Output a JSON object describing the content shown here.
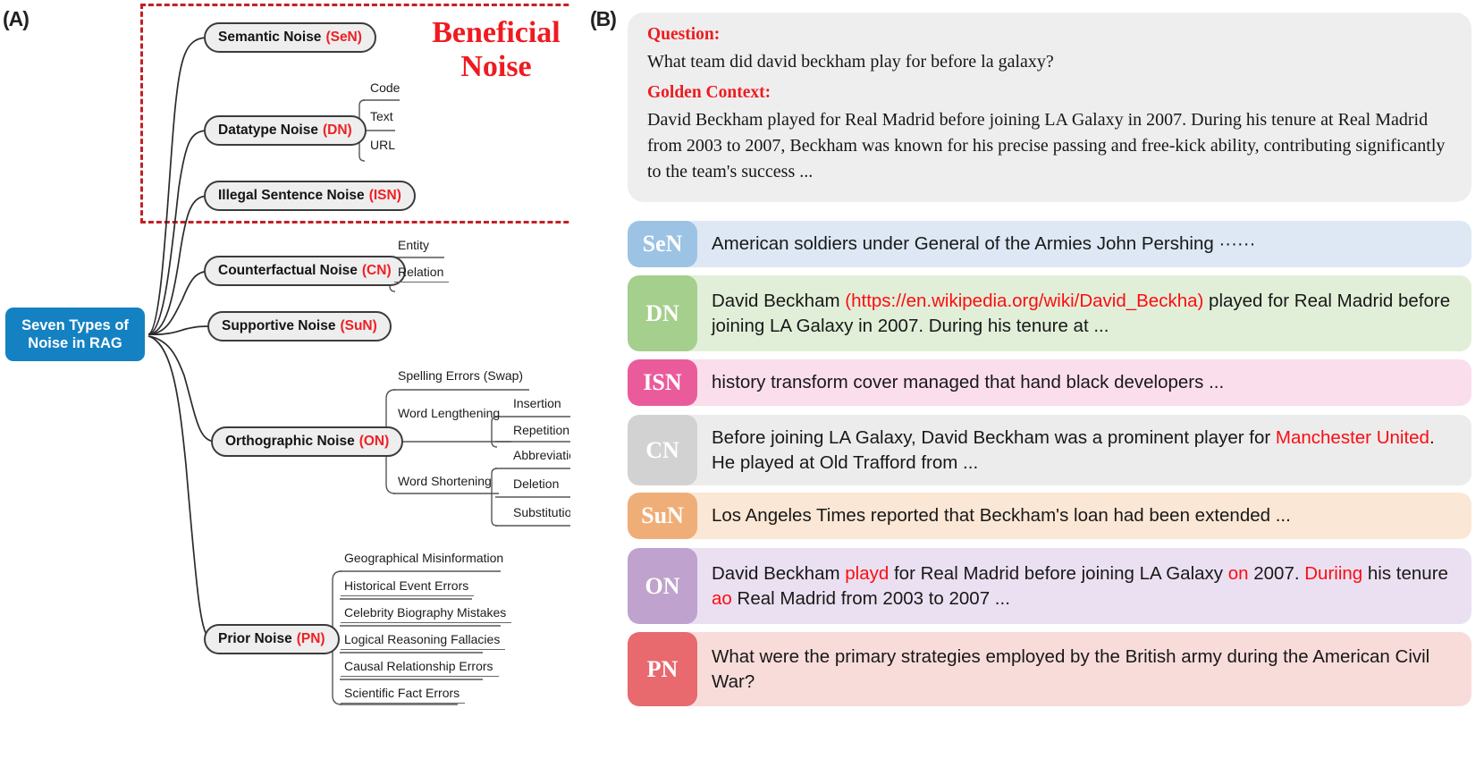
{
  "panels": {
    "a_label": "(A)",
    "b_label": "(B)"
  },
  "diagram": {
    "beneficial_title": "Beneficial Noise",
    "root_node": "Seven Types of Noise in RAG",
    "root_color": "#1481c2",
    "accent_color": "#ef2024",
    "dashed_border_color": "#c32026",
    "branches": [
      {
        "label": "Semantic Noise",
        "abbr": "(SeN)",
        "children": []
      },
      {
        "label": "Datatype Noise",
        "abbr": "(DN)",
        "children": [
          "Code",
          "Text",
          "URL"
        ]
      },
      {
        "label": "Illegal Sentence Noise",
        "abbr": "(ISN)",
        "children": []
      },
      {
        "label": "Counterfactual Noise",
        "abbr": "(CN)",
        "children": [
          "Entity",
          "Relation"
        ]
      },
      {
        "label": "Supportive Noise",
        "abbr": "(SuN)",
        "children": []
      },
      {
        "label": "Orthographic Noise",
        "abbr": "(ON)",
        "children": [
          "Spelling Errors (Swap)",
          "Word Lengthening",
          "Word Shortening"
        ],
        "grandchildren": [
          "Insertion",
          "Repetition",
          "Abbreviation",
          "Deletion",
          "Substitution"
        ]
      },
      {
        "label": "Prior Noise",
        "abbr": "(PN)",
        "children": [
          "Geographical Misinformation",
          "Historical Event Errors",
          "Celebrity Biography Mistakes",
          "Logical Reasoning Fallacies",
          "Causal Relationship Errors",
          "Scientific Fact Errors"
        ]
      }
    ]
  },
  "examples": {
    "question_header": "Question:",
    "question_text": "What team did david beckham play for before la galaxy?",
    "context_header": "Golden Context:",
    "context_text": "David Beckham played for Real Madrid before joining LA Galaxy in 2007. During his tenure at Real Madrid from 2003 to 2007, Beckham was known for his precise passing and free-kick ability, contributing significantly to the team's success ...",
    "rows": [
      {
        "tag": "SeN",
        "tag_color": "#9cc3e3",
        "row_color": "#dde8f4",
        "segments": [
          {
            "t": "American soldiers under General of the Armies John Pershing ······",
            "hl": false
          }
        ]
      },
      {
        "tag": "DN",
        "tag_color": "#a5cf8c",
        "row_color": "#e2efd8",
        "segments": [
          {
            "t": "David Beckham ",
            "hl": false
          },
          {
            "t": "(https://en.wikipedia.org/wiki/David_Beckha)",
            "hl": true
          },
          {
            "t": " played for Real Madrid before joining LA Galaxy in 2007. During his tenure at ...",
            "hl": false
          }
        ]
      },
      {
        "tag": "ISN",
        "tag_color": "#ea5b9c",
        "row_color": "#fbdeeb",
        "segments": [
          {
            "t": "history transform cover managed that hand black developers ...",
            "hl": false
          }
        ]
      },
      {
        "tag": "CN",
        "tag_color": "#d2d2d2",
        "row_color": "#ececec",
        "segments": [
          {
            "t": "Before joining LA Galaxy, David Beckham was a prominent player for ",
            "hl": false
          },
          {
            "t": "Manchester United",
            "hl": true
          },
          {
            "t": ". He played at Old Trafford from ...",
            "hl": false
          }
        ]
      },
      {
        "tag": "SuN",
        "tag_color": "#efae77",
        "row_color": "#fbe7d5",
        "segments": [
          {
            "t": "Los Angeles Times reported that Beckham's loan had been extended ...",
            "hl": false
          }
        ]
      },
      {
        "tag": "ON",
        "tag_color": "#bfa2cd",
        "row_color": "#ebe0f1",
        "segments": [
          {
            "t": "David Beckham ",
            "hl": false
          },
          {
            "t": "playd",
            "hl": true
          },
          {
            "t": " for Real Madrid before joining LA Galaxy ",
            "hl": false
          },
          {
            "t": "on",
            "hl": true
          },
          {
            "t": " 2007. ",
            "hl": false
          },
          {
            "t": "Duriing",
            "hl": true
          },
          {
            "t": " his tenure ",
            "hl": false
          },
          {
            "t": "ao",
            "hl": true
          },
          {
            "t": " Real Madrid from 2003 to 2007 ...",
            "hl": false
          }
        ]
      },
      {
        "tag": "PN",
        "tag_color": "#e8696e",
        "row_color": "#f8dcda",
        "segments": [
          {
            "t": "What were the primary strategies employed by the British army during the American Civil War?",
            "hl": false
          }
        ]
      }
    ]
  }
}
